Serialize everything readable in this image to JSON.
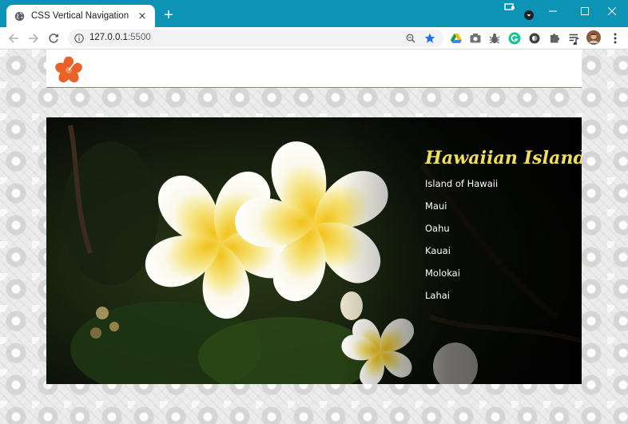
{
  "browser": {
    "tab": {
      "title": "CSS Vertical Navigation",
      "favicon": "globe-icon",
      "close": "×"
    },
    "new_tab": "+",
    "address": {
      "host": "127.0.0.1",
      "port": ":5500"
    },
    "accent": "#0c93b6"
  },
  "page": {
    "logo": "hibiscus-logo",
    "nav": {
      "heading": "Hawaiian Islands",
      "heading_color": "#f1df5a",
      "items": [
        {
          "label": "Island of Hawaii"
        },
        {
          "label": "Maui"
        },
        {
          "label": "Oahu"
        },
        {
          "label": "Kauai"
        },
        {
          "label": "Molokai"
        },
        {
          "label": "Lahai"
        }
      ]
    }
  }
}
